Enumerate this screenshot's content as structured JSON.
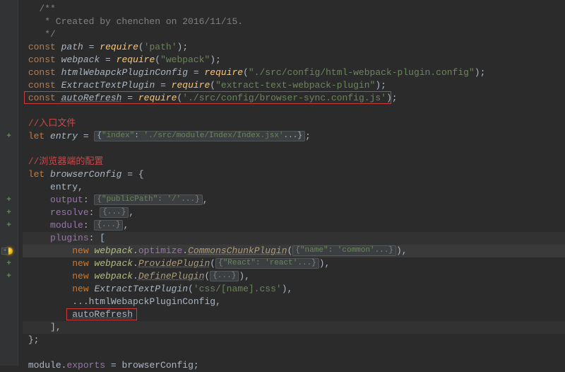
{
  "comment": {
    "l1": "/**",
    "l2": " * Created by chenchen on 2016/11/15.",
    "l3": " */"
  },
  "requires": {
    "kw_const": "const",
    "path_id": "path",
    "eq": " = ",
    "require": "require",
    "path_arg": "'path'",
    "semi": ";",
    "webpack_id": "webpack",
    "webpack_arg": "\"webpack\"",
    "htmlCfg_id": "htmlWebapckPluginConfig",
    "htmlCfg_arg": "\"./src/config/html-webpack-plugin.config\"",
    "extract_id": "ExtractTextPlugin",
    "extract_arg": "\"extract-text-webpack-plugin\"",
    "autoRefresh_id": "autoRefresh",
    "autoRefresh_arg": "'./src/config/browser-sync.config.js'"
  },
  "entry": {
    "comment": "//入口文件",
    "kw_let": "let",
    "id": "entry",
    "obj_open": "{",
    "key": "\"index\"",
    "val": "'./src/module/Index/Index.jsx'",
    "ellipsis": "...",
    "obj_close": "}",
    "semi": ";"
  },
  "browser": {
    "comment": "//浏览器端的配置",
    "kw_let": "let",
    "id": "browserConfig",
    "eq": " = {",
    "p_entry": "entry",
    "comma": ",",
    "p_output": "output",
    "output_val_key": "\"publicPath\"",
    "output_val_v": "'/'",
    "p_resolve": "resolve",
    "p_module": "module",
    "p_plugins": "plugins",
    "plugins_open": ": [",
    "new": "new",
    "webpack": "webpack",
    "optimize": "optimize",
    "commons": "CommonsChunkPlugin",
    "commons_key": "\"name\"",
    "commons_val": "'common'",
    "provide": "ProvidePlugin",
    "provide_key": "\"React\"",
    "provide_val": "'react'",
    "define": "DefinePlugin",
    "extract": "ExtractTextPlugin",
    "extract_arg": "'css/[name].css'",
    "spread": "...",
    "htmlCfg": "htmlWebapckPluginConfig",
    "autoRefresh": "autoRefresh",
    "close_arr": "],",
    "close_obj": "};"
  },
  "export": {
    "module": "module",
    "exports": "exports",
    "eq": " = ",
    "id": "browserConfig",
    "semi": ";"
  },
  "fold_generic": "{...}"
}
